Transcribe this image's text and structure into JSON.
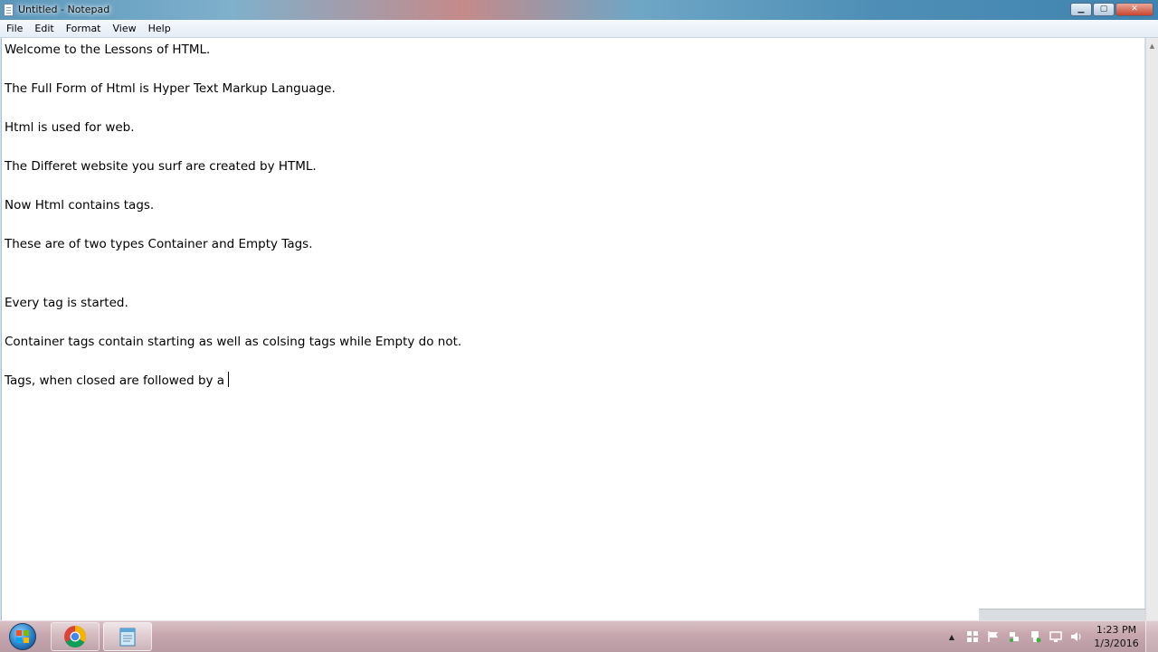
{
  "window": {
    "title": "Untitled - Notepad",
    "buttons": {
      "minimize": "▁",
      "maximize": "▢",
      "close": "✕"
    }
  },
  "menu": [
    "File",
    "Edit",
    "Format",
    "View",
    "Help"
  ],
  "editor": {
    "lines": [
      "Welcome to the Lessons of HTML.",
      "The Full Form of Html is Hyper Text Markup Language.",
      "Html is used for web.",
      "The Differet website you surf are created by HTML.",
      "Now Html contains tags.",
      "These are of two types Container and Empty Tags.",
      "Every tag is started.",
      "Container tags contain starting as well as colsing tags while Empty do not.",
      "Tags, when closed are followed by a"
    ]
  },
  "taskbar": {
    "apps": [
      {
        "name": "chrome",
        "icon": "chrome-icon"
      },
      {
        "name": "notepad",
        "icon": "notepad-icon"
      }
    ],
    "tray_icons": [
      "show-hidden-icon",
      "windows-flag-icon",
      "action-center-flag-icon",
      "network-icon",
      "usb-icon",
      "display-icon",
      "volume-icon"
    ],
    "clock": {
      "time": "1:23 PM",
      "date": "1/3/2016"
    }
  }
}
